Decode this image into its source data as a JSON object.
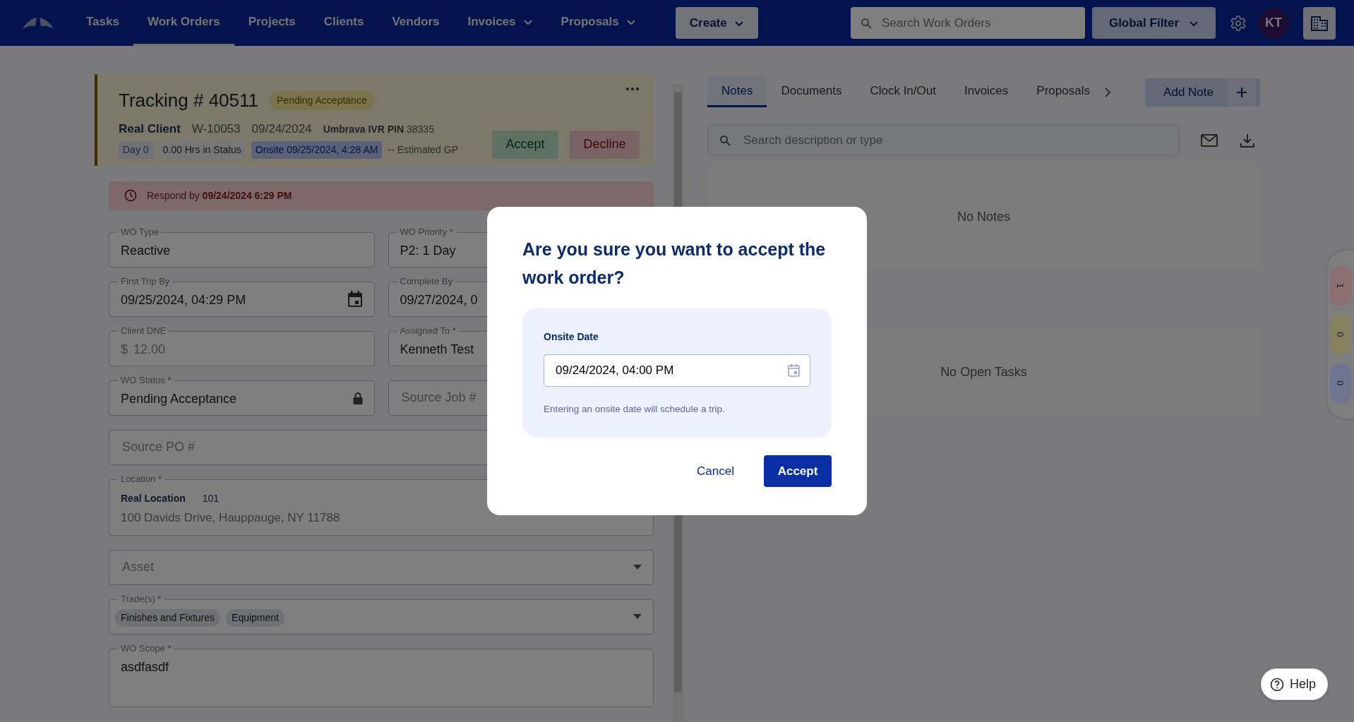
{
  "nav": {
    "items": [
      {
        "label": "Tasks",
        "selected": false,
        "kind": "link"
      },
      {
        "label": "Work Orders",
        "selected": true,
        "kind": "link"
      },
      {
        "label": "Projects",
        "selected": false,
        "kind": "link"
      },
      {
        "label": "Clients",
        "selected": false,
        "kind": "link"
      },
      {
        "label": "Vendors",
        "selected": false,
        "kind": "link"
      },
      {
        "label": "Invoices",
        "selected": false,
        "kind": "dropdown"
      },
      {
        "label": "Proposals",
        "selected": false,
        "kind": "dropdown"
      }
    ],
    "create_button": "Create",
    "search": {
      "placeholder": "Search Work Orders"
    },
    "global_filter": "Global Filter",
    "avatar": "KT"
  },
  "work_order": {
    "title": "Tracking # 40511",
    "status_badge": "Pending Acceptance",
    "client": "Real Client",
    "wo_number": "W-10053",
    "date": "09/24/2024",
    "ivr_label": "Umbrava IVR PIN",
    "ivr_pin": "38335",
    "chips": [
      {
        "text": "Day 0",
        "kind": "day"
      },
      {
        "text": "0.00 Hrs in Status",
        "kind": "plain"
      },
      {
        "text": "Onsite 09/25/2024, 4:28 AM",
        "kind": "onsite"
      }
    ],
    "estimated_gp": "-- Estimated GP",
    "accept_button": "Accept",
    "decline_button": "Decline"
  },
  "alert": "Respond by **09/24/2024 6:29 PM**",
  "field_rows": [
    [
      {
        "kind": "text",
        "label": "WO Type",
        "value": "Reactive"
      },
      {
        "kind": "text",
        "label": "WO Priority *",
        "value": "P2: 1 Day"
      }
    ],
    [
      {
        "kind": "date",
        "label": "First Trip By",
        "value": "09/25/2024, 04:29 PM"
      },
      {
        "kind": "text",
        "label": "Complete By",
        "value": "09/27/2024, 0"
      }
    ],
    [
      {
        "kind": "money",
        "label": "Client DNE",
        "prefix": "$",
        "value": "12.00"
      },
      {
        "kind": "text",
        "label": "Assigned To *",
        "value": "Kenneth Test"
      }
    ],
    [
      {
        "kind": "locked",
        "label": "WO Status *",
        "value": "Pending Acceptance"
      },
      {
        "kind": "placeholder",
        "placeholder": "Source Job #"
      }
    ],
    [
      {
        "kind": "placeholder",
        "placeholder": "Source PO #"
      }
    ],
    [
      {
        "kind": "location",
        "label": "Location *",
        "name": "Real Location",
        "code": "101",
        "address": "100 Davids Drive, Hauppauge, NY 11788"
      }
    ],
    [
      {
        "kind": "select",
        "placeholder": "Asset"
      }
    ],
    [
      {
        "kind": "tags",
        "label": "Trade(s) *",
        "tags": [
          "Finishes and Fixtures",
          "Equipment"
        ]
      }
    ],
    [
      {
        "kind": "textarea",
        "label": "WO Scope *",
        "value": "asdfasdf"
      }
    ]
  ],
  "panel": {
    "tabs": [
      {
        "label": "Notes",
        "selected": true
      },
      {
        "label": "Documents",
        "selected": false
      },
      {
        "label": "Clock In/Out",
        "selected": false
      },
      {
        "label": "Invoices",
        "selected": false
      },
      {
        "label": "Proposals",
        "selected": false
      }
    ],
    "add_note_button": "Add Note",
    "search": {
      "placeholder": "Search description or type"
    },
    "notes_empty": "No Notes",
    "tasks_empty": "No Open Tasks"
  },
  "side_counters": [
    {
      "value": "1",
      "color": "#8e6f71"
    },
    {
      "value": "0",
      "color": "#86815e"
    },
    {
      "value": "0",
      "color": "#6f7591"
    }
  ],
  "modal": {
    "title": "Are you sure you want to accept the work order?",
    "field_label": "Onsite Date",
    "field_value": "09/24/2024, 04:00 PM",
    "hint": "Entering an onsite date will schedule a trip.",
    "cancel_button": "Cancel",
    "accept_button": "Accept"
  },
  "help_button": "Help"
}
